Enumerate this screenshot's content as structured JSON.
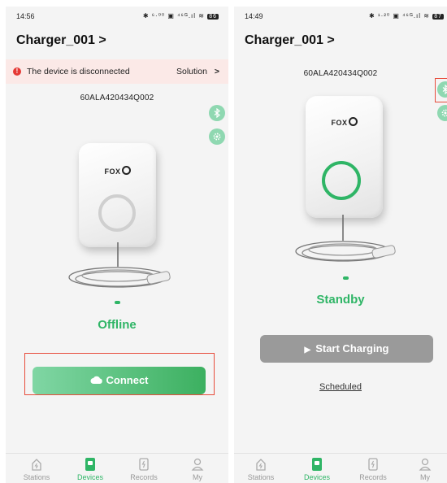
{
  "left": {
    "status": {
      "time": "14:56",
      "icons": "✱ ⁶·⁰⁰ ▣ ⁴⁶ᴳ.ıl ≋",
      "battery": "86"
    },
    "device_title": "Charger_001",
    "title_chevron": ">",
    "banner": {
      "message": "The device is disconnected",
      "action": "Solution",
      "chevron": ">",
      "error_mark": "!"
    },
    "serial": "60ALA420434Q002",
    "brand": "FOX",
    "state": "Offline",
    "connect_label": "Connect",
    "tabs": [
      "Stations",
      "Devices",
      "Records",
      "My"
    ]
  },
  "right": {
    "status": {
      "time": "14:49",
      "icons": "✱ ¹·²⁰ ▣ ⁴⁶ᴳ.ıl ≋",
      "battery": "87"
    },
    "device_title": "Charger_001",
    "title_chevron": ">",
    "serial": "60ALA420434Q002",
    "brand": "FOX",
    "state": "Standby",
    "start_label": "Start Charging",
    "scheduled_label": "Scheduled",
    "tabs": [
      "Stations",
      "Devices",
      "Records",
      "My"
    ]
  },
  "colors": {
    "accent": "#2fb566",
    "highlight": "#e74c3c",
    "banner_bg": "#fbe9e7",
    "disabled_button": "#9a9a9a"
  }
}
